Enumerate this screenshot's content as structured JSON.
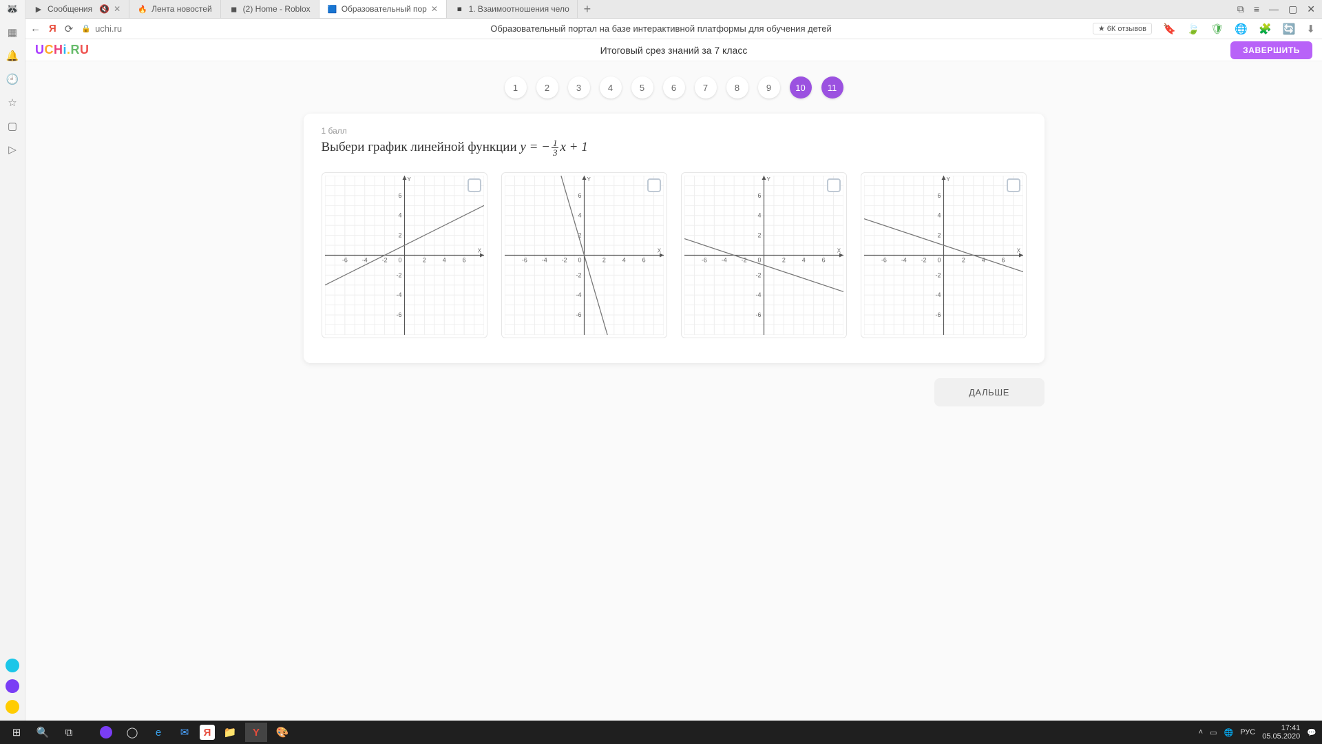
{
  "browser": {
    "tabs": [
      {
        "label": "Сообщения",
        "icon": "▶",
        "muted": true,
        "close": true
      },
      {
        "label": "Лента новостей",
        "icon": "🔥",
        "close": false
      },
      {
        "label": "(2) Home - Roblox",
        "icon": "◼",
        "close": false
      },
      {
        "label": "Образовательный пор",
        "icon": "🟦",
        "active": true,
        "close": true
      },
      {
        "label": "1. Взаимоотношения чело",
        "icon": "◾",
        "close": false
      }
    ],
    "url": "uchi.ru",
    "page_title": "Образовательный портал на базе интерактивной платформы для обучения детей",
    "reviews": "★ 6К отзывов"
  },
  "page": {
    "brand": "UCHi.RU",
    "quiz_title": "Итоговый срез знаний за 7 класс",
    "finish": "ЗАВЕРШИТЬ",
    "pager": [
      "1",
      "2",
      "3",
      "4",
      "5",
      "6",
      "7",
      "8",
      "9",
      "10",
      "11"
    ],
    "pager_active": [
      9,
      10
    ],
    "score": "1 балл",
    "question_prefix": "Выбери график линейной функции ",
    "formula": {
      "y": "y",
      "eq": " = −",
      "num": "1",
      "den": "3",
      "x": "x",
      "plus": " + 1"
    },
    "next": "ДАЛЬШЕ"
  },
  "chart_data": [
    {
      "type": "line",
      "title": "",
      "xlabel": "X",
      "ylabel": "Y",
      "xlim": [
        -8,
        8
      ],
      "ylim": [
        -8,
        8
      ],
      "ticks": [
        -6,
        -4,
        -2,
        0,
        2,
        4,
        6
      ],
      "series": [
        {
          "name": "",
          "x": [
            -8,
            8
          ],
          "y": [
            -3,
            5
          ]
        }
      ],
      "desc": "y = 0.5x + 1"
    },
    {
      "type": "line",
      "title": "",
      "xlabel": "X",
      "ylabel": "Y",
      "xlim": [
        -8,
        8
      ],
      "ylim": [
        -8,
        8
      ],
      "ticks": [
        -6,
        -4,
        -2,
        0,
        2,
        4,
        6
      ],
      "series": [
        {
          "name": "",
          "x": [
            -2.33,
            2.33
          ],
          "y": [
            8,
            -8
          ]
        }
      ],
      "desc": "y = -3x + 1"
    },
    {
      "type": "line",
      "title": "",
      "xlabel": "X",
      "ylabel": "Y",
      "xlim": [
        -8,
        8
      ],
      "ylim": [
        -8,
        8
      ],
      "ticks": [
        -6,
        -4,
        -2,
        0,
        2,
        4,
        6
      ],
      "series": [
        {
          "name": "",
          "x": [
            -8,
            8
          ],
          "y": [
            1.667,
            -3.667
          ]
        }
      ],
      "desc": "y = -(1/3)x - 1"
    },
    {
      "type": "line",
      "title": "",
      "xlabel": "X",
      "ylabel": "Y",
      "xlim": [
        -8,
        8
      ],
      "ylim": [
        -8,
        8
      ],
      "ticks": [
        -6,
        -4,
        -2,
        0,
        2,
        4,
        6
      ],
      "series": [
        {
          "name": "",
          "x": [
            -8,
            8
          ],
          "y": [
            3.667,
            -1.667
          ]
        }
      ],
      "desc": "y = -(1/3)x + 1"
    }
  ],
  "tray": {
    "lang": "РУС",
    "time": "17:41",
    "date": "05.05.2020"
  }
}
